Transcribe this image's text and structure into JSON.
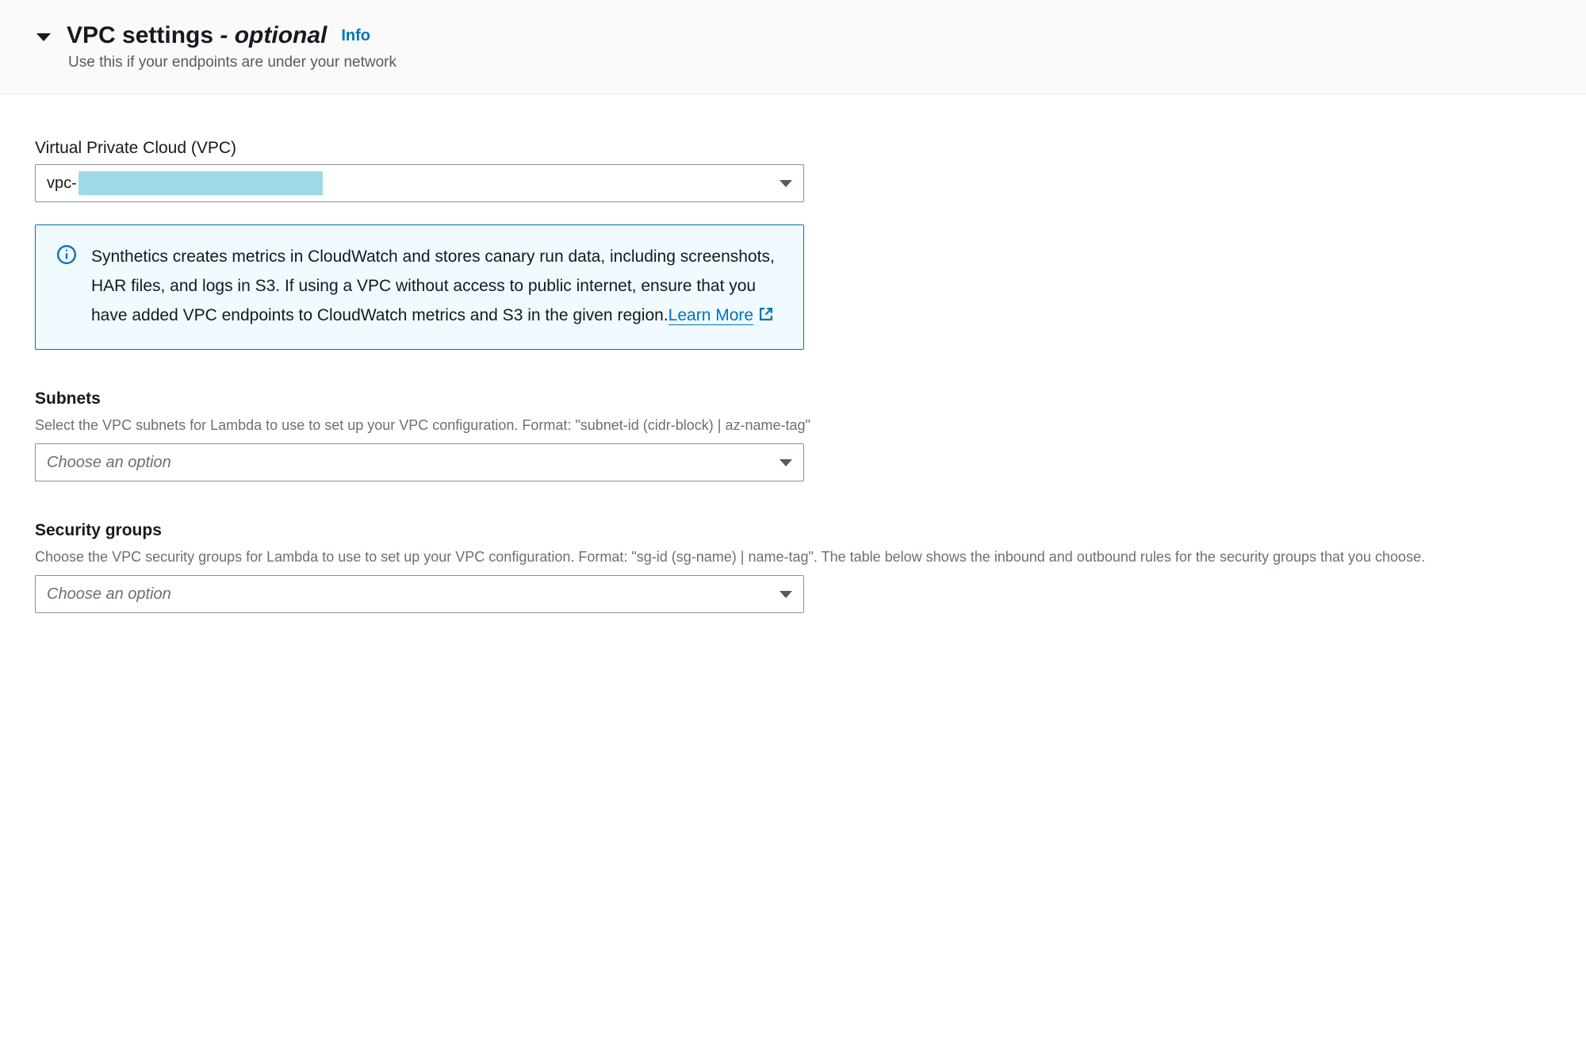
{
  "header": {
    "title_main": "VPC settings",
    "title_optional": "- optional",
    "info_label": "Info",
    "subtitle": "Use this if your endpoints are under your network"
  },
  "vpc": {
    "label": "Virtual Private Cloud (VPC)",
    "value_prefix": "vpc-"
  },
  "alert": {
    "text": "Synthetics creates metrics in CloudWatch and stores canary run data, including screenshots, HAR files, and logs in S3. If using a VPC without access to public internet, ensure that you have added VPC endpoints to CloudWatch metrics and S3 in the given region.",
    "learn_more": "Learn More"
  },
  "subnets": {
    "label": "Subnets",
    "description": "Select the VPC subnets for Lambda to use to set up your VPC configuration. Format: \"subnet-id (cidr-block) | az-name-tag\"",
    "placeholder": "Choose an option"
  },
  "security_groups": {
    "label": "Security groups",
    "description": "Choose the VPC security groups for Lambda to use to set up your VPC configuration. Format: \"sg-id (sg-name) | name-tag\". The table below shows the inbound and outbound rules for the security groups that you choose.",
    "placeholder": "Choose an option"
  }
}
